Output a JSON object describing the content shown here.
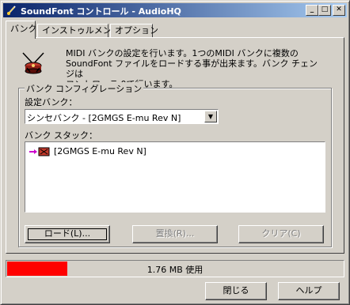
{
  "window": {
    "title": "SoundFont コントロール - AudioHQ",
    "controls": {
      "minimize": "_",
      "maximize": "□",
      "close": "✕"
    }
  },
  "tabs": [
    {
      "label": "バンク",
      "active": true
    },
    {
      "label": "インストゥルメント",
      "active": false
    },
    {
      "label": "オプション",
      "active": false
    }
  ],
  "info": {
    "icon": "soundfont-drum-icon",
    "text": "MIDI バンクの設定を行います。1つのMIDI バンクに複数の\nSoundFont ファイルをロードする事が出来ます。バンク チェンジは\nコントローラ 0で行います。"
  },
  "bank_config": {
    "group_label": "バンク コンフィグレーション",
    "selected_bank_label": "設定バンク：",
    "selected_bank_value": "シンセバンク - [2GMGS E-mu  Rev N]",
    "stack_label": "バンク スタック：",
    "stack_items": [
      {
        "label": "[2GMGS E-mu  Rev N]",
        "icon": "soundfont-stack-icon"
      }
    ]
  },
  "buttons": {
    "load": "ロード(L)...",
    "replace": "置換(R)...",
    "clear": "クリア(C)"
  },
  "status": {
    "usage_text": "1.76 MB 使用",
    "usage_fraction": 0.18,
    "fill_color": "#ff0000"
  },
  "footer": {
    "close": "閉じる",
    "help": "ヘルプ"
  }
}
